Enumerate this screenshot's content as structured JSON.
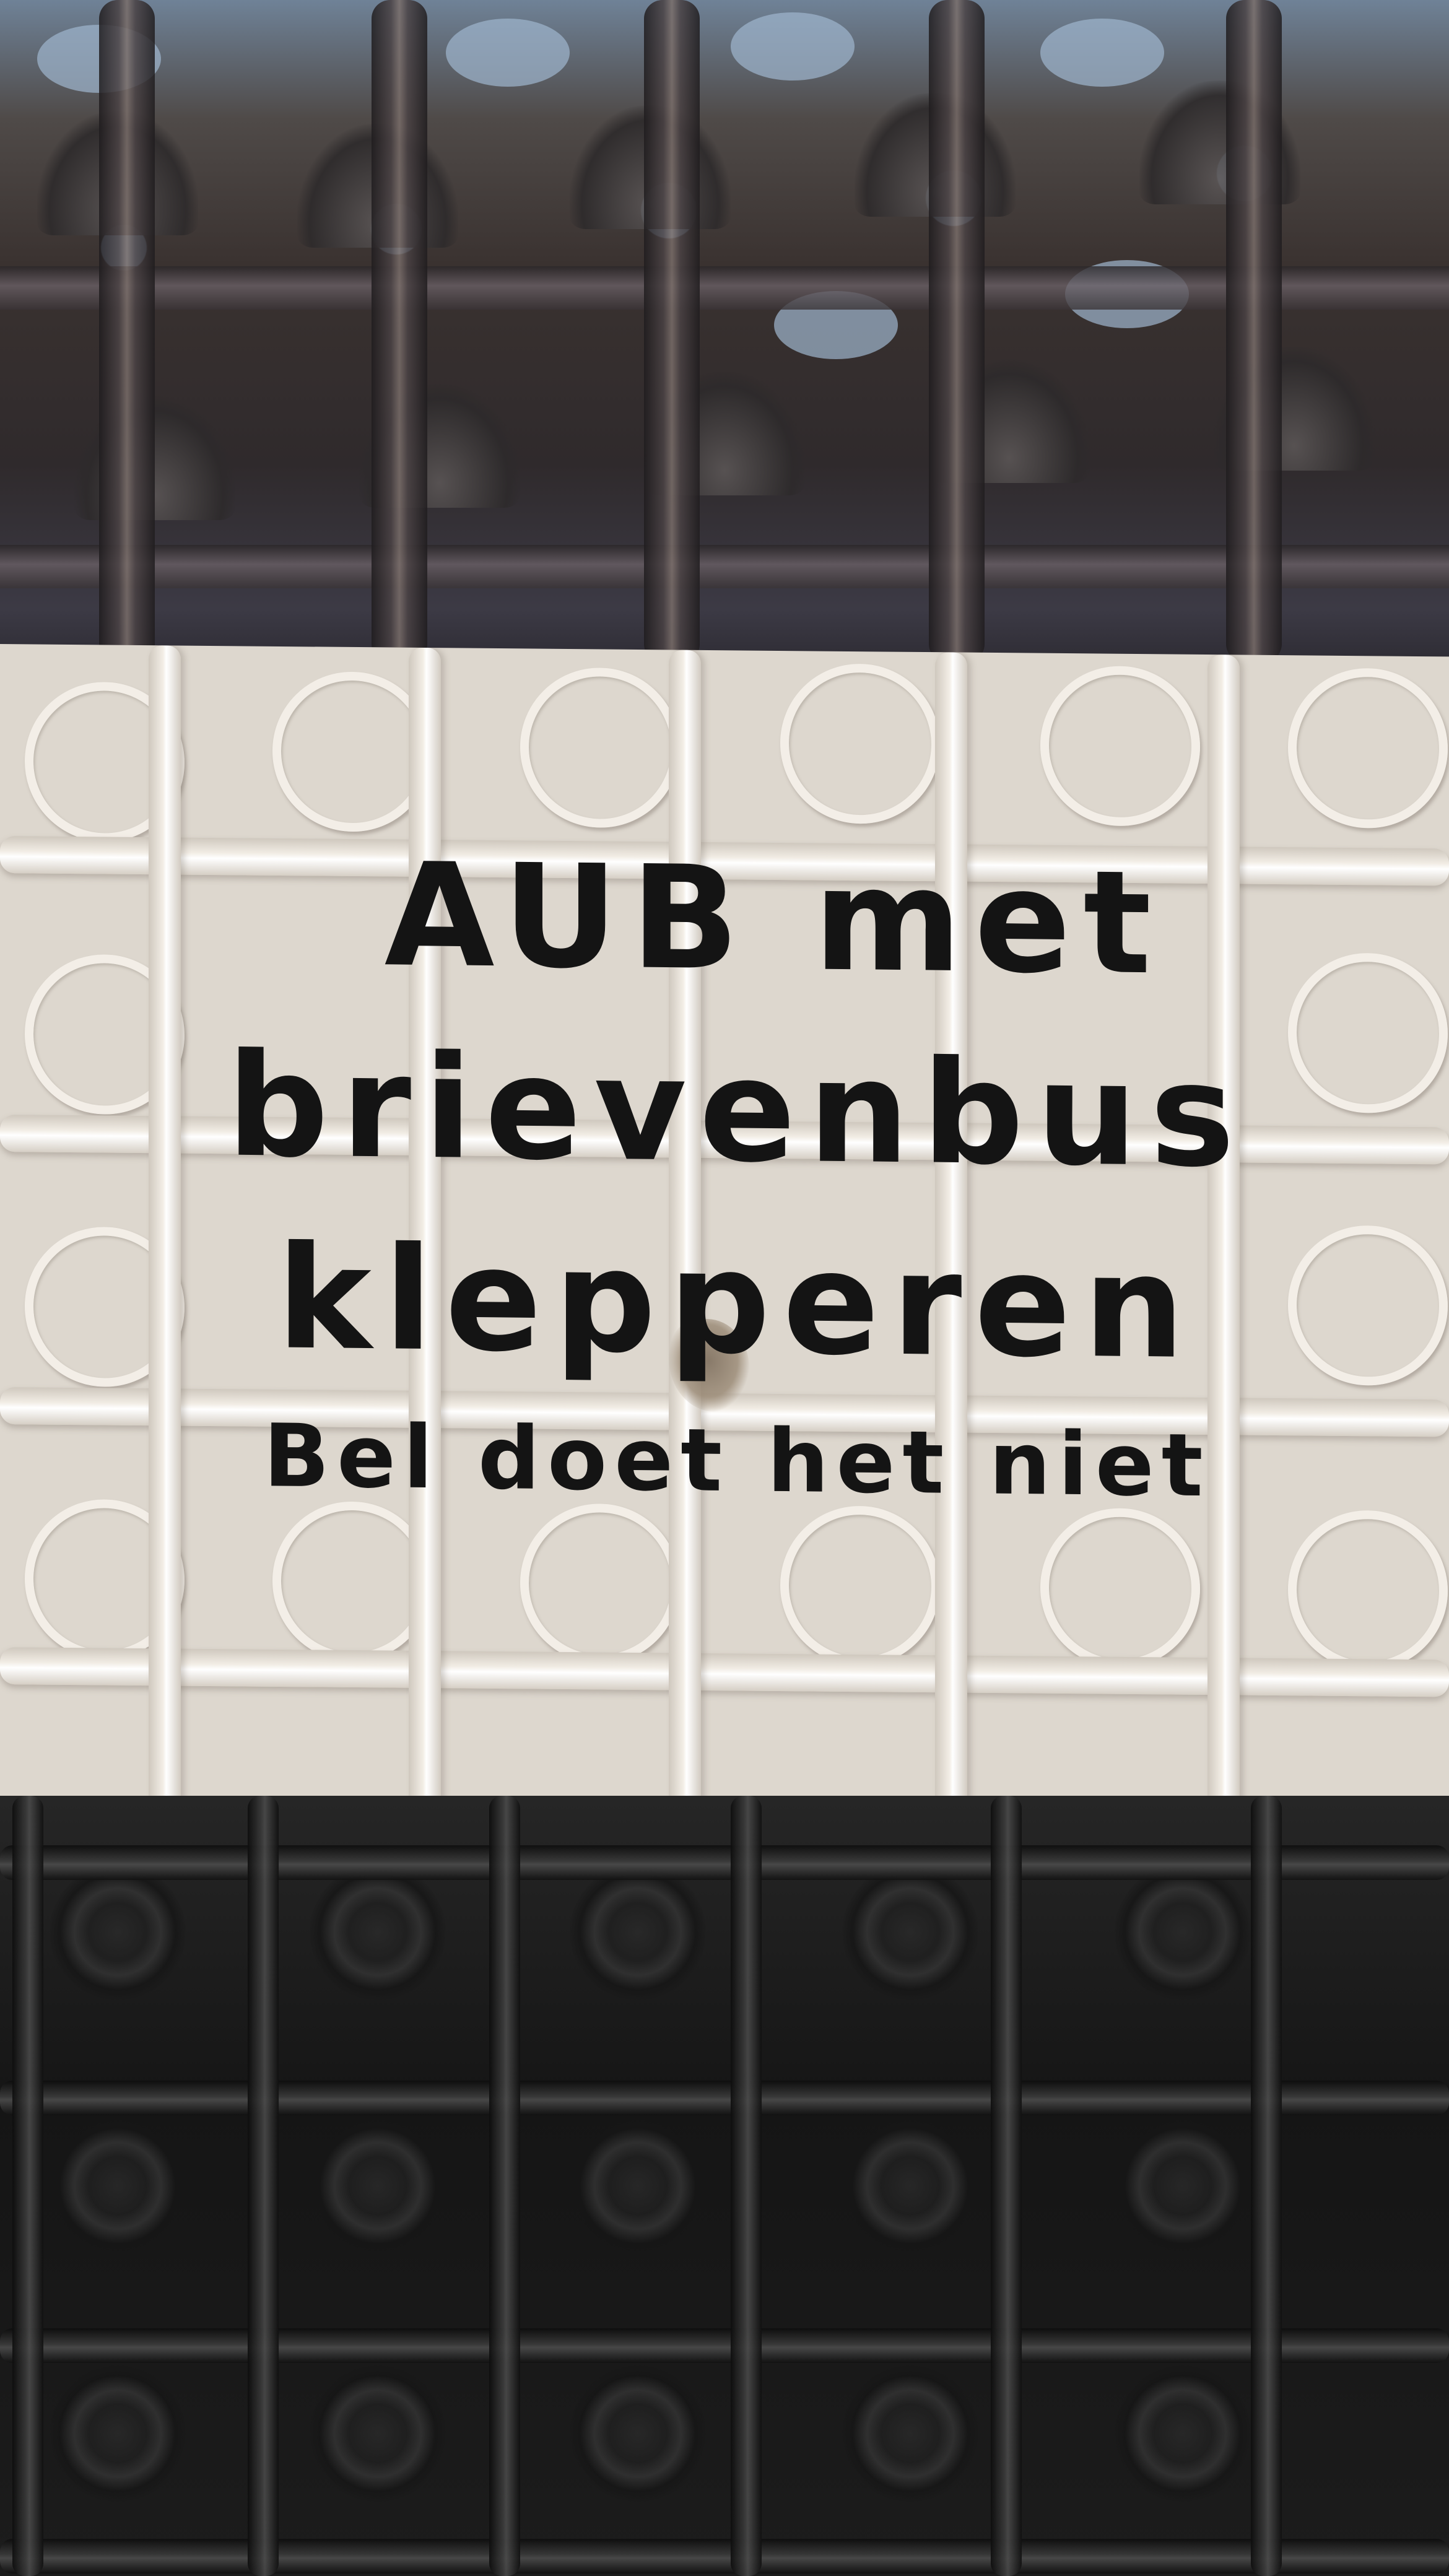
{
  "sign": {
    "line1": "AUB met",
    "line2": "brievenbus",
    "line3": "klepperen",
    "line4": "Bel doet het niet"
  },
  "colors": {
    "sticker": "#ddd7ce",
    "text": "#141414",
    "glass_top": "#4f4a48",
    "panel_bottom": "#151515"
  }
}
